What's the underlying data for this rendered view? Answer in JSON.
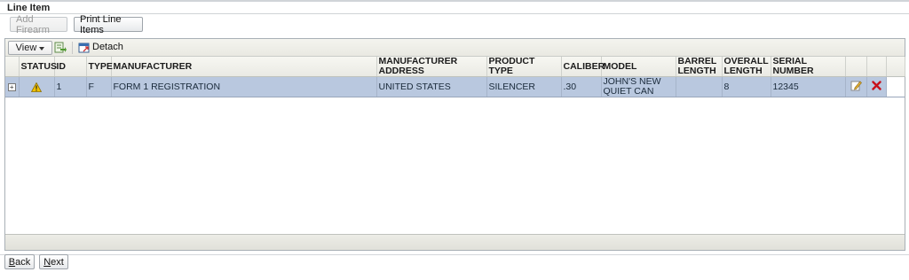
{
  "section": {
    "title": "Line Item"
  },
  "actions": {
    "add_firearm": "Add Firearm",
    "print_line_items": "Print Line Items"
  },
  "toolbar": {
    "view_label": "View",
    "detach_label": "Detach"
  },
  "table": {
    "columns": [
      "STATUS",
      "ID",
      "TYPE",
      "MANUFACTURER",
      "MANUFACTURER ADDRESS",
      "PRODUCT TYPE",
      "CALIBER",
      "MODEL",
      "BARREL LENGTH",
      "OVERALL LENGTH",
      "SERIAL NUMBER"
    ],
    "rows": [
      {
        "status_icon": "warning-icon",
        "id": "1",
        "type": "F",
        "manufacturer": "FORM 1 REGISTRATION",
        "manufacturer_address": "UNITED STATES",
        "product_type": "SILENCER",
        "caliber": ".30",
        "model": "JOHN'S NEW QUIET CAN",
        "barrel_length": "",
        "overall_length": "8",
        "serial_number": "12345",
        "edit_icon": "edit-icon",
        "delete_icon": "delete-icon"
      }
    ]
  },
  "nav": {
    "back_prefix": "B",
    "back_rest": "ack",
    "next_prefix": "N",
    "next_rest": "ext"
  },
  "colors": {
    "selected_row": "#b9c8df",
    "delete_icon": "#c8101a",
    "warning_icon": "#f2c200"
  }
}
